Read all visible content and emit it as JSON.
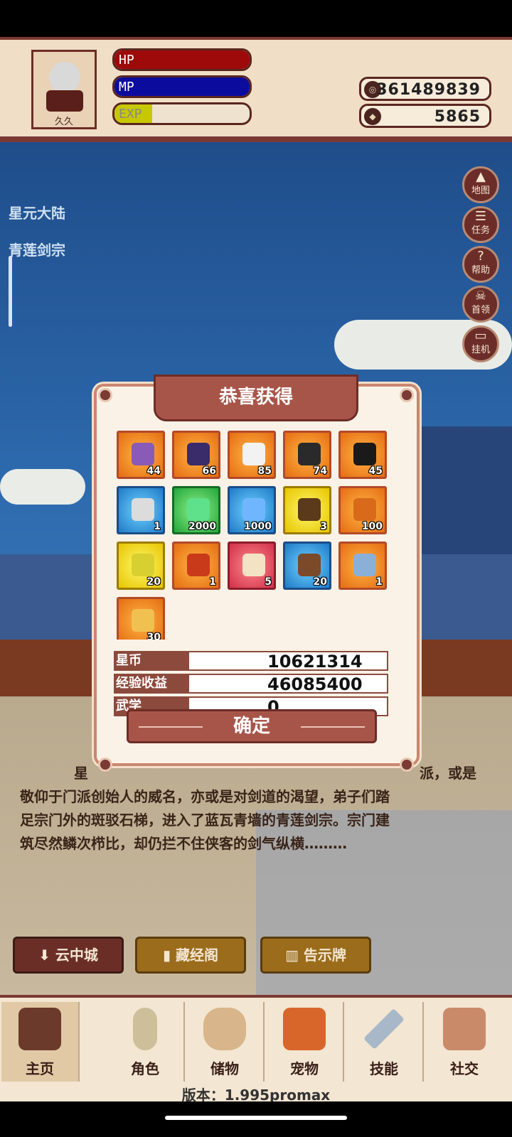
{
  "player": {
    "name": "久久",
    "hp_label": "HP",
    "mp_label": "MP",
    "exp_label": "EXP",
    "hp_fill": 1.0,
    "mp_fill": 1.0,
    "exp_fill": 0.28,
    "coins": "361489839",
    "gems": "5865"
  },
  "location": {
    "region": "星元大陆",
    "place": "青莲剑宗"
  },
  "side_buttons": [
    {
      "label": "地图",
      "icon": "mountain-icon"
    },
    {
      "label": "任务",
      "icon": "scroll-icon"
    },
    {
      "label": "帮助",
      "icon": "question-icon"
    },
    {
      "label": "首领",
      "icon": "boss-icon"
    },
    {
      "label": "挂机",
      "icon": "monitor-icon"
    }
  ],
  "modal": {
    "title": "恭喜获得",
    "items": [
      {
        "count": "44",
        "bg": "orange",
        "color": "#8a5ab8"
      },
      {
        "count": "66",
        "bg": "orange",
        "color": "#3a2b6a"
      },
      {
        "count": "85",
        "bg": "orange",
        "color": "#f2f2f2"
      },
      {
        "count": "74",
        "bg": "orange",
        "color": "#2a2a2a"
      },
      {
        "count": "45",
        "bg": "orange",
        "color": "#1a1a1a"
      },
      {
        "count": "1",
        "bg": "blue",
        "color": "#dcdcdc"
      },
      {
        "count": "2000",
        "bg": "green",
        "color": "#5fe08a"
      },
      {
        "count": "1000",
        "bg": "blue",
        "color": "#6fb6ff"
      },
      {
        "count": "3",
        "bg": "yellow",
        "color": "#5a3a1a"
      },
      {
        "count": "100",
        "bg": "orange",
        "color": "#d86a1a"
      },
      {
        "count": "20",
        "bg": "yellow",
        "color": "#d8d030"
      },
      {
        "count": "1",
        "bg": "orange",
        "color": "#c93a1a"
      },
      {
        "count": "5",
        "bg": "red",
        "color": "#f3e2c3"
      },
      {
        "count": "20",
        "bg": "blue",
        "color": "#7b4a2a"
      },
      {
        "count": "1",
        "bg": "orange",
        "color": "#8ab0d8"
      },
      {
        "count": "30",
        "bg": "orange",
        "color": "#f0c050"
      }
    ],
    "stats": [
      {
        "label": "星币",
        "value": "10621314"
      },
      {
        "label": "经验收益",
        "value": "46085400"
      },
      {
        "label": "武学",
        "value": "0"
      }
    ],
    "confirm": "确定"
  },
  "story": {
    "line1_start": "星",
    "line1_end": "派，或是",
    "line2": "敬仰于门派创始人的威名，亦或是对剑道的渴望，弟子们踏",
    "line3": "足宗门外的斑驳石梯，进入了蓝瓦青墙的青莲剑宗。宗门建",
    "line4": "筑尽然鳞次栉比，却仍拦不住侠客的剑气纵横………"
  },
  "nav_buttons": [
    {
      "label": "云中城",
      "icon": "down-arrow-icon"
    },
    {
      "label": "藏经阁",
      "icon": "book-icon"
    },
    {
      "label": "告示牌",
      "icon": "signboard-icon"
    }
  ],
  "tabs": [
    {
      "label": "主页",
      "icon": "home-gate-icon",
      "active": true
    },
    {
      "label": "角色",
      "icon": "character-icon",
      "active": false
    },
    {
      "label": "储物",
      "icon": "bag-icon",
      "active": false
    },
    {
      "label": "宠物",
      "icon": "fox-icon",
      "active": false
    },
    {
      "label": "技能",
      "icon": "sword-icon",
      "active": false
    },
    {
      "label": "社交",
      "icon": "handshake-icon",
      "active": false
    }
  ],
  "version": "版本：1.995promax"
}
